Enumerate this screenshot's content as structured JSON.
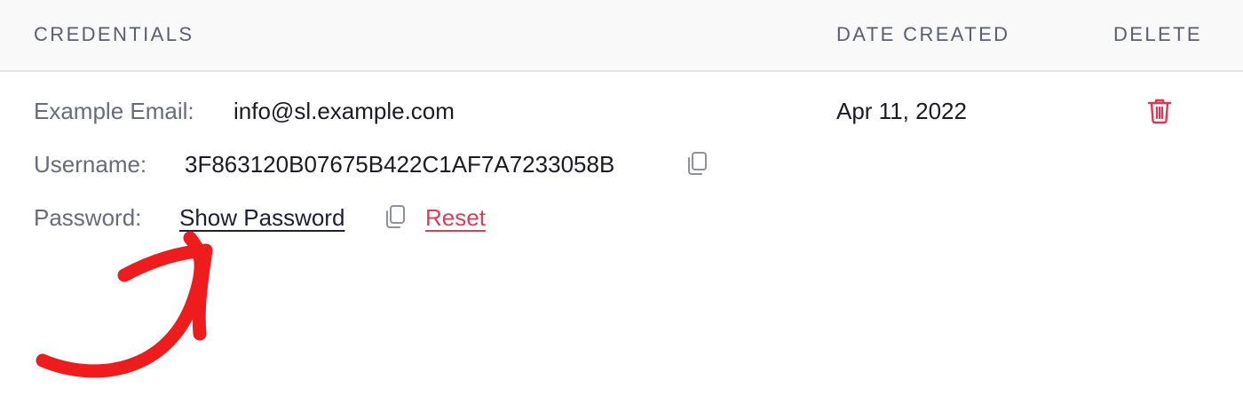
{
  "header": {
    "credentials": "CREDENTIALS",
    "date_created": "DATE CREATED",
    "delete": "DELETE"
  },
  "row": {
    "email_label": "Example Email:",
    "email_value": "info@sl.example.com",
    "username_label": "Username:",
    "username_value": "3F863120B07675B422C1AF7A7233058B",
    "password_label": "Password:",
    "show_password": "Show Password",
    "reset": "Reset",
    "date": "Apr 11, 2022"
  },
  "icons": {
    "copy": "copy-icon",
    "delete": "trash-icon",
    "annotation": "hand-drawn-arrow"
  },
  "colors": {
    "header_bg": "#f9f9fa",
    "reset": "#e23b55",
    "trash": "#d93a52",
    "arrow": "#ee1c1c"
  }
}
